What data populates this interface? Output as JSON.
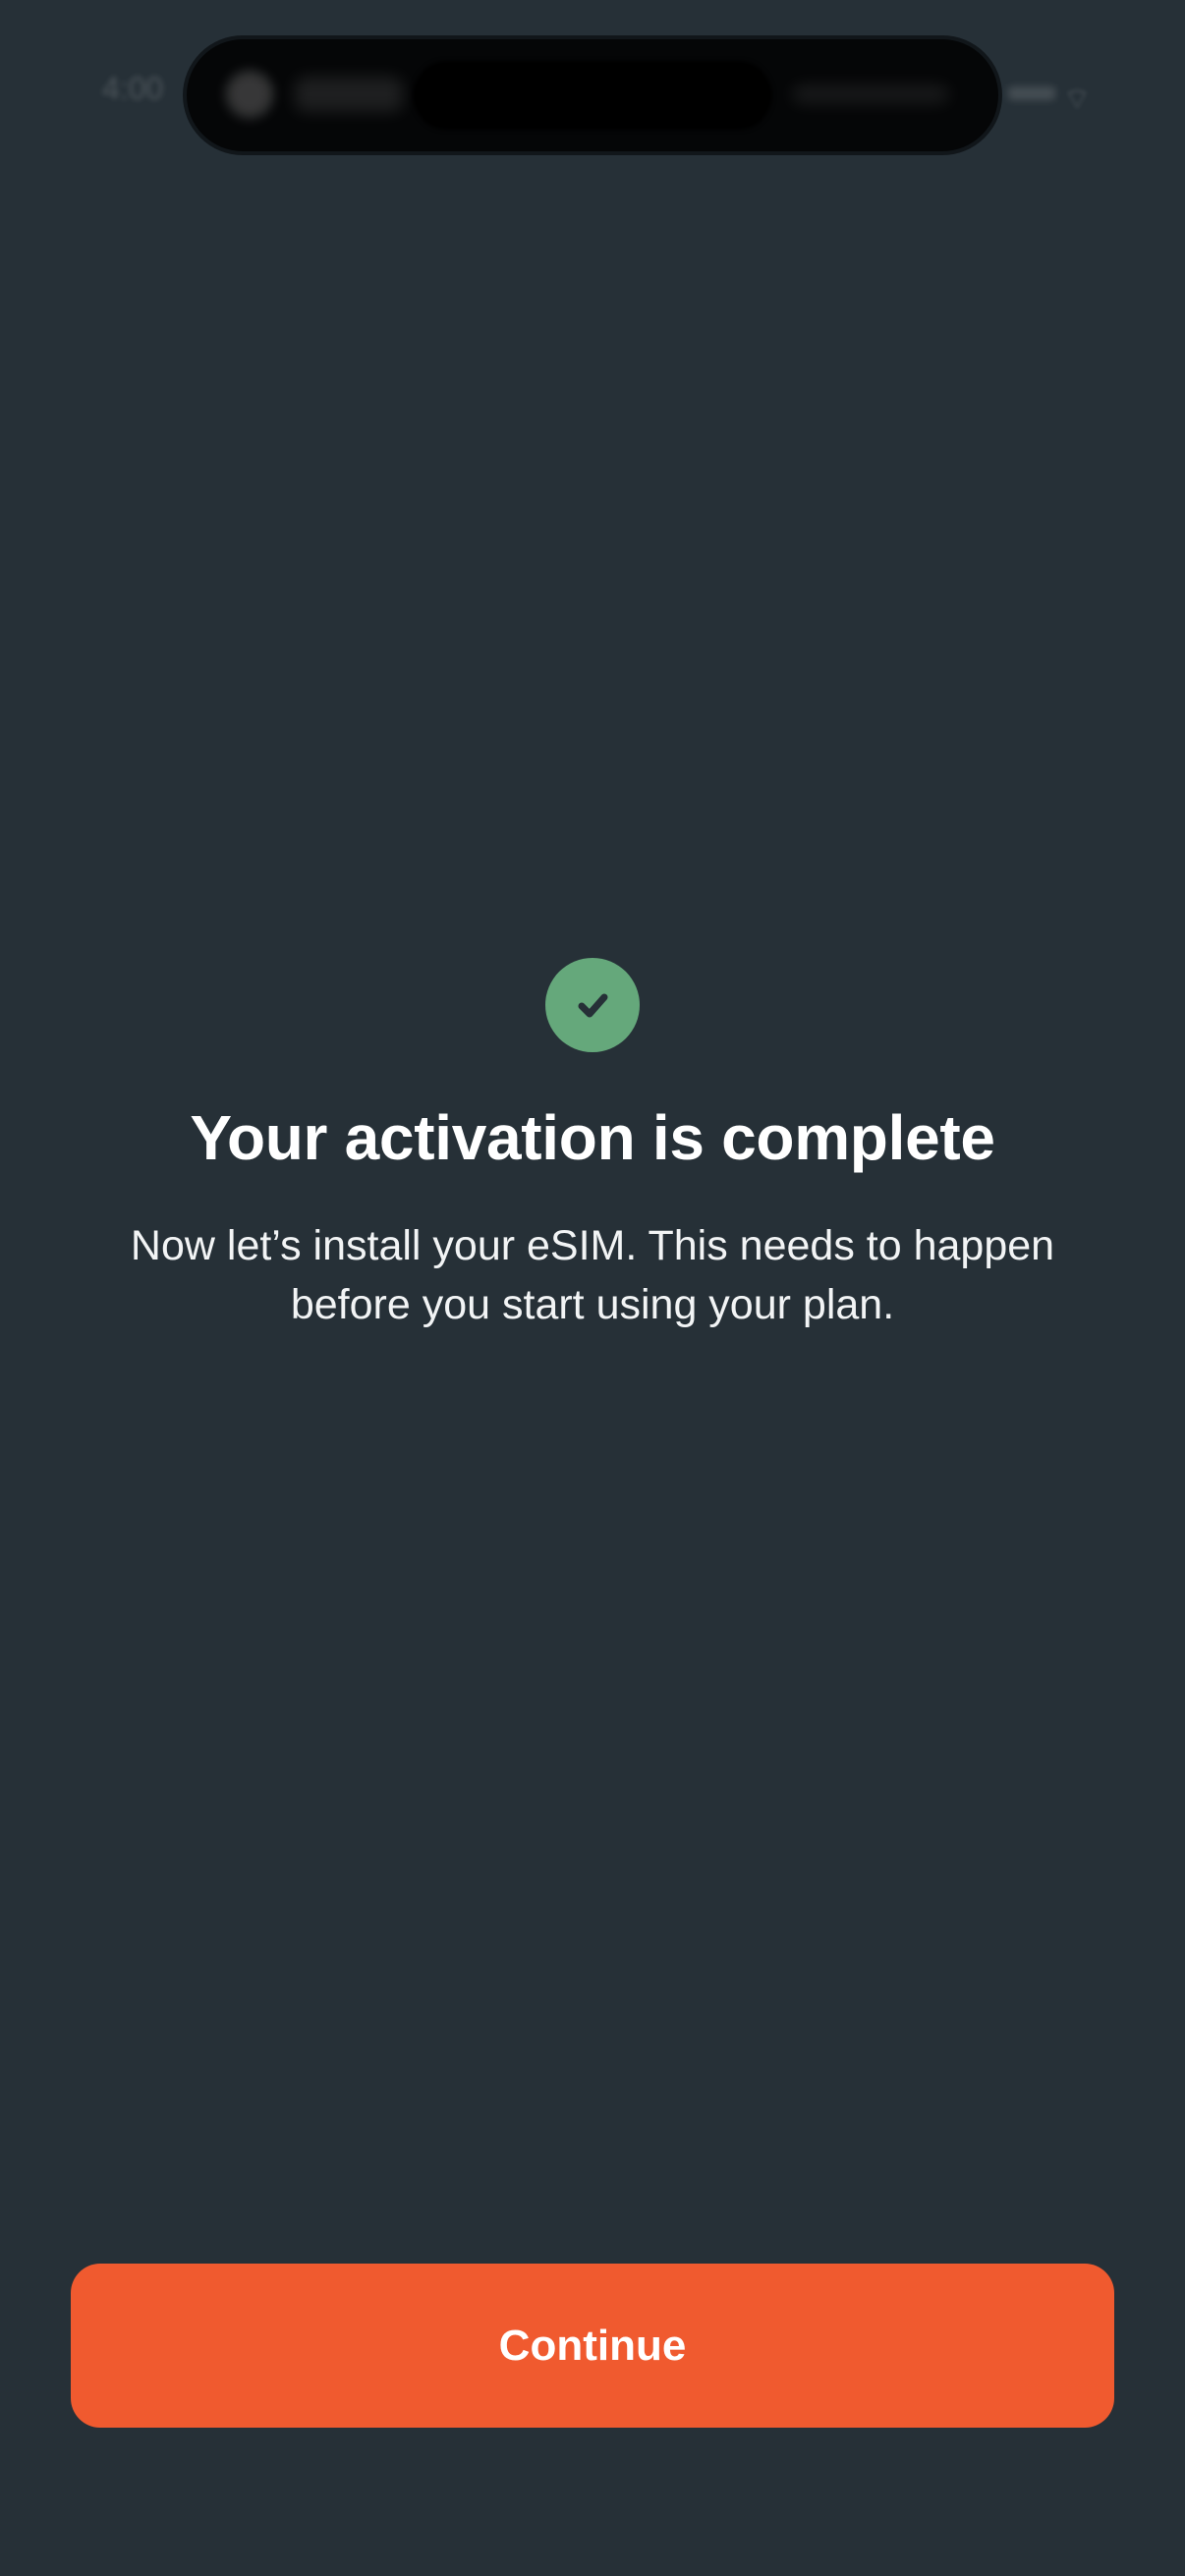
{
  "status_bar": {
    "time": "4:00",
    "wifi_icon": "wifi-icon"
  },
  "success": {
    "icon": "check-icon",
    "color": "#65a87b"
  },
  "screen": {
    "title": "Your activation is complete",
    "message": "Now let’s install your eSIM. This needs to happen before you start using your plan."
  },
  "actions": {
    "continue_label": "Continue",
    "continue_color": "#f05a2f"
  }
}
